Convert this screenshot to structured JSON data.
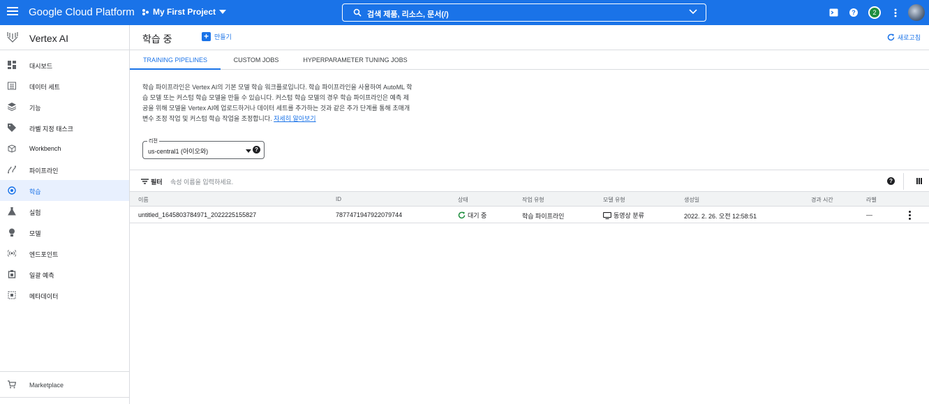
{
  "topbar": {
    "brand": "Google Cloud Platform",
    "project": "My First Project",
    "search_text": "검색   제품, 리소스, 문서(/)",
    "notification_count": "2"
  },
  "sidebar": {
    "title": "Vertex AI",
    "items": [
      {
        "label": "대시보드",
        "icon": "dashboard-icon"
      },
      {
        "label": "데이터 세트",
        "icon": "dataset-icon"
      },
      {
        "label": "기능",
        "icon": "feature-icon"
      },
      {
        "label": "라벨 지정 태스크",
        "icon": "label-icon"
      },
      {
        "label": "Workbench",
        "icon": "workbench-icon"
      },
      {
        "label": "파이프라인",
        "icon": "pipeline-icon"
      },
      {
        "label": "학습",
        "icon": "training-icon"
      },
      {
        "label": "실험",
        "icon": "experiment-icon"
      },
      {
        "label": "모델",
        "icon": "model-icon"
      },
      {
        "label": "엔드포인트",
        "icon": "endpoint-icon"
      },
      {
        "label": "일괄 예측",
        "icon": "batch-prediction-icon"
      },
      {
        "label": "메타데이터",
        "icon": "metadata-icon"
      }
    ],
    "marketplace": "Marketplace"
  },
  "header": {
    "title": "학습 중",
    "create_label": "만들기",
    "refresh_label": "새로고침"
  },
  "tabs": [
    {
      "label": "TRAINING PIPELINES"
    },
    {
      "label": "CUSTOM JOBS"
    },
    {
      "label": "HYPERPARAMETER TUNING JOBS"
    }
  ],
  "description": {
    "text": "학습 파이프라인은 Vertex AI의 기본 모델 학습 워크플로입니다. 학습 파이프라인을 사용하여 AutoML 학습 모델 또는 커스텀 학습 모델을 만들 수 있습니다. 커스텀 학습 모델의 경우 학습 파이프라인은 예측 제공을 위해 모델을 Vertex AI에 업로드하거나 데이터 세트를 추가하는 것과 같은 추가 단계를 통해 초매개변수 조정 작업 및 커스텀 학습 작업을 조정합니다.",
    "link": "자세히 알아보기"
  },
  "region": {
    "legend": "리전",
    "value": "us-central1 (아이오와)"
  },
  "filter": {
    "label": "필터",
    "placeholder": "속성 이름을 입력하세요."
  },
  "table": {
    "headers": [
      "이름",
      "ID",
      "상태",
      "작업 유형",
      "모델 유형",
      "생성일",
      "경과 시간",
      "라벨"
    ],
    "rows": [
      {
        "name": "untitled_1645803784971_2022225155827",
        "id": "7877471947922079744",
        "status": "대기 중",
        "job_type": "학습 파이프라인",
        "model_type": "동영상 분류",
        "created": "2022. 2. 26. 오전 12:58:51",
        "elapsed": "",
        "labels": "—"
      }
    ]
  }
}
